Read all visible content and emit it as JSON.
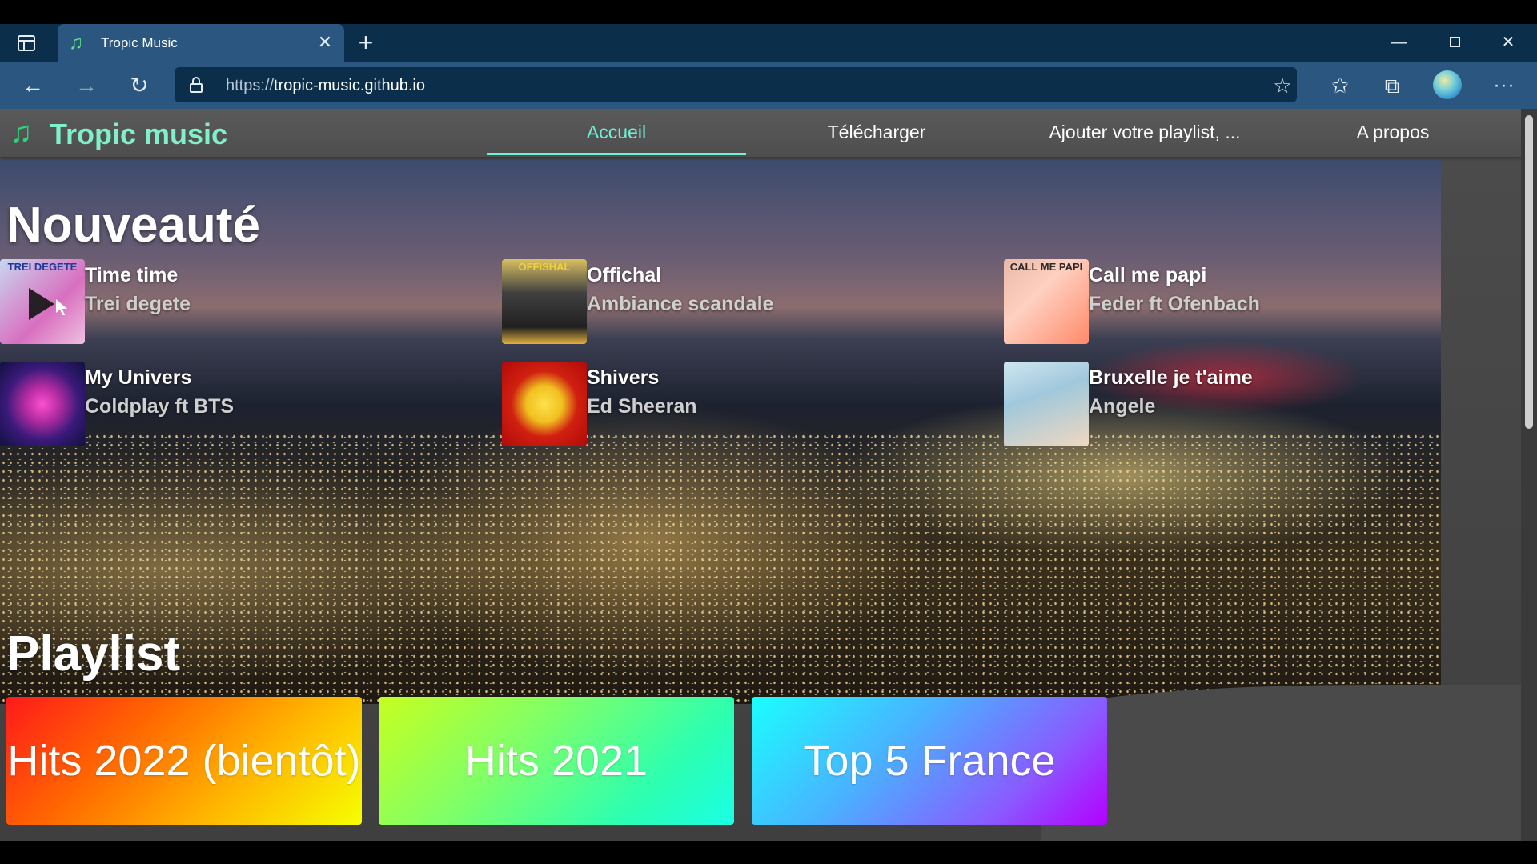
{
  "browser": {
    "tab_title": "Tropic Music",
    "tab_close_icon": "close-icon",
    "new_tab_icon": "plus-icon",
    "url_protocol": "https://",
    "url_host": "tropic-music.github.io",
    "window_controls": [
      "minimize-icon",
      "restore-icon",
      "close-icon"
    ],
    "toolbar_icons": [
      "add-favorite-icon",
      "favorites-icon",
      "collections-icon",
      "profile-avatar",
      "more-icon"
    ]
  },
  "site": {
    "logo": "Tropic music",
    "logo_icon": "music-note-icon",
    "accent": "#6ff0d8",
    "nav": [
      {
        "label": "Accueil",
        "active": true
      },
      {
        "label": "Télécharger",
        "active": false
      },
      {
        "label": "Ajouter votre playlist, ...",
        "active": false
      },
      {
        "label": "A propos",
        "active": false
      }
    ]
  },
  "nouveaute": {
    "title": "Nouveauté",
    "songs": [
      {
        "title": "Time time",
        "artist": "Trei degete",
        "cover_text": "TREI DEGETE"
      },
      {
        "title": "Offichal",
        "artist": "Ambiance scandale",
        "cover_text": "OFFISHAL"
      },
      {
        "title": "Call me papi",
        "artist": "Feder ft Ofenbach",
        "cover_text": "CALL ME PAPI"
      },
      {
        "title": "My Univers",
        "artist": "Coldplay ft BTS",
        "cover_text": ""
      },
      {
        "title": "Shivers",
        "artist": "Ed Sheeran",
        "cover_text": ""
      },
      {
        "title": "Bruxelle je t'aime",
        "artist": "Angele",
        "cover_text": ""
      }
    ]
  },
  "playlist": {
    "title": "Playlist",
    "items": [
      {
        "label": "Hits 2022 (bientôt)"
      },
      {
        "label": "Hits 2021"
      },
      {
        "label": "Top 5 France"
      }
    ]
  }
}
